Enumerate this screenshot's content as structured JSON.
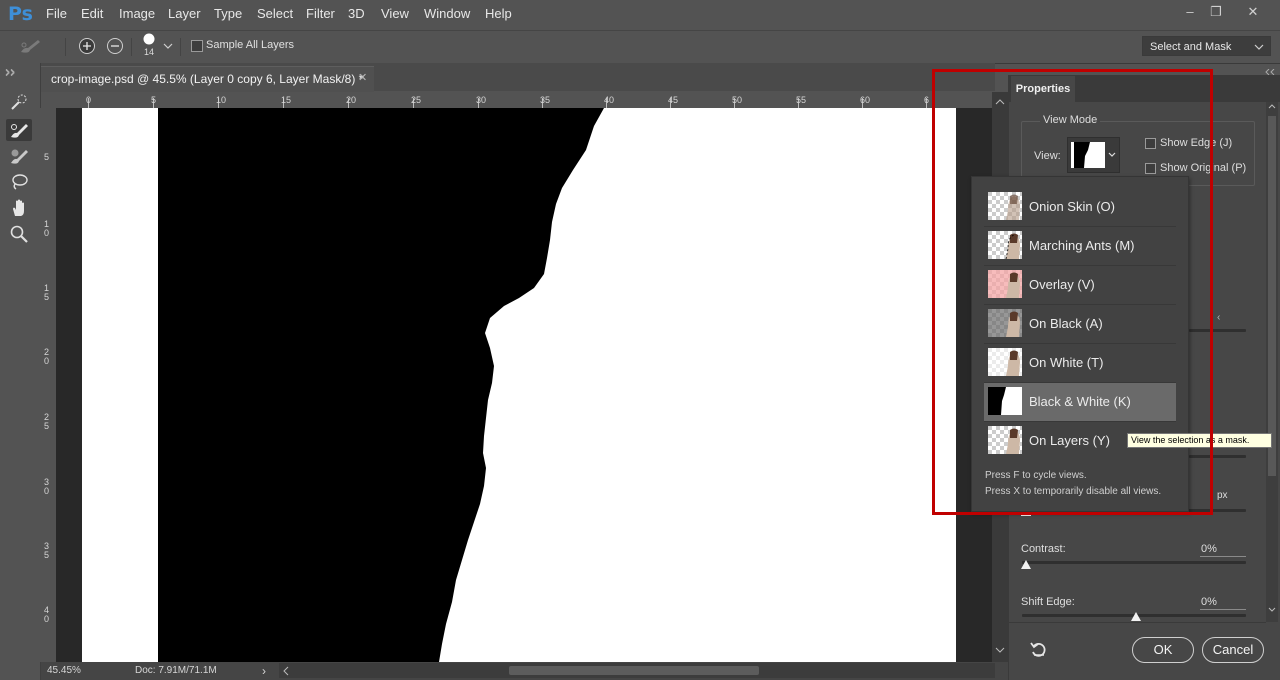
{
  "app": {
    "logo": "Ps"
  },
  "menu": {
    "items": [
      "File",
      "Edit",
      "Image",
      "Layer",
      "Type",
      "Select",
      "Filter",
      "3D",
      "View",
      "Window",
      "Help"
    ]
  },
  "window_controls": {
    "minimize": "‒",
    "restore": "❐",
    "close": "✕"
  },
  "options_bar": {
    "brush_size": "14",
    "sample_all_layers": "Sample All Layers",
    "workspace": "Select and Mask"
  },
  "document": {
    "tab_title": "crop-image.psd @ 45.5% (Layer 0 copy 6, Layer Mask/8) *",
    "close": "✕"
  },
  "rulers": {
    "top": [
      "0",
      "5",
      "10",
      "15",
      "20",
      "25",
      "30",
      "35",
      "40",
      "45",
      "50",
      "55",
      "60",
      "6"
    ],
    "left": [
      "5",
      "1 0",
      "1 5",
      "2 0",
      "2 5",
      "3 0",
      "3 5",
      "4 0"
    ]
  },
  "status": {
    "zoom": "45.45%",
    "doc_size": "Doc: 7.91M/71.1M",
    "arrow": "›"
  },
  "properties": {
    "tab": "Properties",
    "view_mode_label": "View Mode",
    "view_label": "View:",
    "show_edge": "Show Edge (J)",
    "show_original": "Show Original (P)",
    "contrast_label": "Contrast:",
    "contrast_value": "0%",
    "shift_edge_label": "Shift Edge:",
    "shift_edge_value": "0%",
    "px_unit": "px",
    "ok": "OK",
    "cancel": "Cancel"
  },
  "view_menu": {
    "items": [
      {
        "label": "Onion Skin (O)",
        "thumb": "onion-skin"
      },
      {
        "label": "Marching Ants (M)",
        "thumb": "marching-ants"
      },
      {
        "label": "Overlay (V)",
        "thumb": "overlay"
      },
      {
        "label": "On Black (A)",
        "thumb": "on-black"
      },
      {
        "label": "On White (T)",
        "thumb": "on-white"
      },
      {
        "label": "Black & White (K)",
        "thumb": "black-white",
        "selected": true
      },
      {
        "label": "On Layers (Y)",
        "thumb": "on-layers"
      }
    ],
    "hint_1": "Press F to cycle views.",
    "hint_2": "Press X to temporarily disable all views."
  },
  "tooltip": "View the selection as a mask.",
  "colors": {
    "highlight_box": "#c00000",
    "ps_blue": "#3e8fd8",
    "tooltip_bg": "#ffffe1"
  }
}
